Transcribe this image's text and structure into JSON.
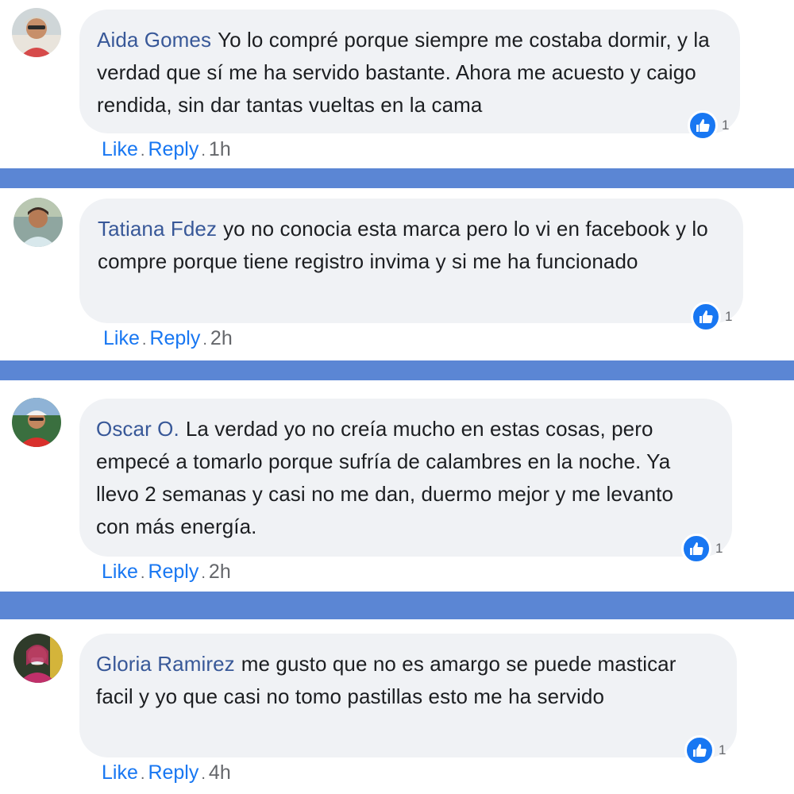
{
  "comments": [
    {
      "author": "Aida Gomes",
      "text": "Yo lo compré porque siempre me costaba dormir, y la verdad que sí me ha servido bastante. Ahora me acuesto y caigo rendida, sin dar tantas vueltas en la cama",
      "reactions": "1",
      "like_label": "Like",
      "reply_label": "Reply",
      "separator": ".",
      "time": "1h"
    },
    {
      "author": "Tatiana Fdez",
      "text": "yo no conocia esta marca pero lo vi en facebook y lo compre porque tiene registro invima y si me ha funcionado",
      "reactions": "1",
      "like_label": "Like",
      "reply_label": "Reply",
      "separator": ".",
      "time": "2h"
    },
    {
      "author": "Oscar O.",
      "text": "La verdad yo no creía mucho en estas cosas, pero empecé a tomarlo porque sufría de calambres en la noche. Ya llevo 2 semanas y casi no me dan, duermo mejor y me levanto con más energía.",
      "reactions": "1",
      "like_label": "Like",
      "reply_label": "Reply",
      "separator": ".",
      "time": "2h"
    },
    {
      "author": "Gloria Ramirez",
      "text": "me gusto que no es amargo se puede masticar facil y yo que casi no tomo pastillas esto me ha servido",
      "reactions": "1",
      "like_label": "Like",
      "reply_label": "Reply",
      "separator": ".",
      "time": "4h"
    }
  ],
  "colors": {
    "author_link": "#385898",
    "action_link": "#1877f2",
    "bubble_bg": "#f0f2f5",
    "divider": "#5b86d4",
    "like_badge": "#1877f2"
  },
  "icons": {
    "like_badge": "thumbs-up-icon"
  }
}
